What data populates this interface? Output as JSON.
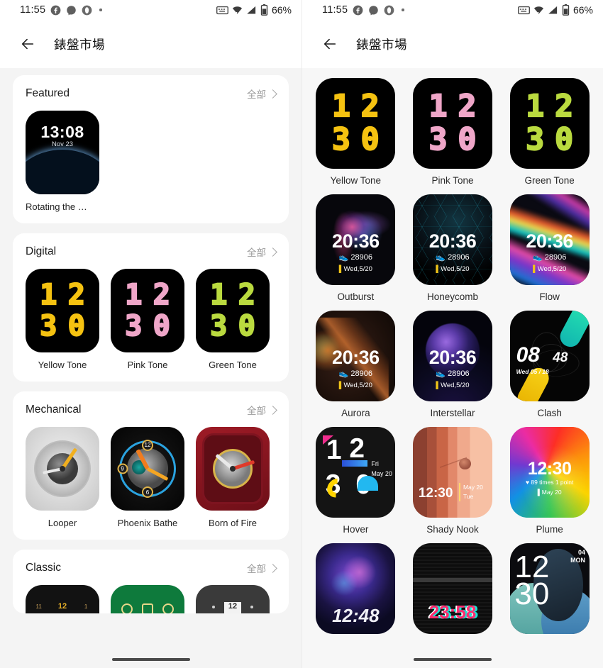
{
  "status_bar": {
    "time": "11:55",
    "battery_percent": "66%",
    "icons": [
      "facebook-icon",
      "messenger-icon",
      "opera-icon",
      "dot-indicator"
    ],
    "right_icons": [
      "keyboard-icon",
      "wifi-icon",
      "signal-icon",
      "battery-icon"
    ]
  },
  "app_bar": {
    "back_label": "back-arrow",
    "title": "錶盤市場"
  },
  "left_panel": {
    "sections": [
      {
        "title": "Featured",
        "more_label": "全部",
        "items": [
          {
            "name": "Rotating the …",
            "art": "earth",
            "time": "13:08",
            "date": "Nov 23"
          }
        ]
      },
      {
        "title": "Digital",
        "more_label": "全部",
        "items": [
          {
            "name": "Yellow Tone",
            "art": "tone",
            "color": "#f5c211",
            "digits": [
              "1",
              "2",
              "3",
              "0"
            ]
          },
          {
            "name": "Pink Tone",
            "art": "tone",
            "color": "#efa6c8",
            "digits": [
              "1",
              "2",
              "3",
              "0"
            ]
          },
          {
            "name": "Green Tone",
            "art": "tone",
            "color": "#bada3f",
            "digits": [
              "1",
              "2",
              "3",
              "0"
            ]
          }
        ]
      },
      {
        "title": "Mechanical",
        "more_label": "全部",
        "items": [
          {
            "name": "Looper",
            "art": "looper"
          },
          {
            "name": "Phoenix Bathe",
            "art": "phoenix"
          },
          {
            "name": "Born of Fire",
            "art": "bornfire"
          }
        ]
      },
      {
        "title": "Classic",
        "more_label": "全部",
        "items": [
          {
            "name": "",
            "art": "classic-black",
            "marks": [
              "11",
              "12",
              "1"
            ]
          },
          {
            "name": "",
            "art": "classic-green"
          },
          {
            "name": "",
            "art": "classic-grey",
            "window": "12"
          }
        ]
      }
    ]
  },
  "right_panel": {
    "grid": [
      {
        "name": "Yellow Tone",
        "art": "tone",
        "color": "#f5c211",
        "digits": [
          "1",
          "2",
          "3",
          "0"
        ]
      },
      {
        "name": "Pink Tone",
        "art": "tone",
        "color": "#efa6c8",
        "digits": [
          "1",
          "2",
          "3",
          "0"
        ]
      },
      {
        "name": "Green Tone",
        "art": "tone",
        "color": "#bada3f",
        "digits": [
          "1",
          "2",
          "3",
          "0"
        ]
      },
      {
        "name": "Outburst",
        "art": "outburst",
        "time": "20:36",
        "steps": "28906",
        "date": "Wed,5/20"
      },
      {
        "name": "Honeycomb",
        "art": "honeycomb",
        "time": "20:36",
        "steps": "28906",
        "date": "Wed,5/20"
      },
      {
        "name": "Flow",
        "art": "flow",
        "time": "20:36",
        "steps": "28906",
        "date": "Wed,5/20"
      },
      {
        "name": "Aurora",
        "art": "aurora",
        "time": "20:36",
        "steps": "28906",
        "date": "Wed,5/20"
      },
      {
        "name": "Interstellar",
        "art": "interstellar",
        "time": "20:36",
        "steps": "28906",
        "date": "Wed,5/20"
      },
      {
        "name": "Clash",
        "art": "clash",
        "hour": "08",
        "minute": "48",
        "date": "Wed 05 / 18"
      },
      {
        "name": "Hover",
        "art": "hover",
        "digits": [
          "1",
          "2",
          "3",
          "0"
        ],
        "day": "Fri",
        "date": "May 20"
      },
      {
        "name": "Shady Nook",
        "art": "shady",
        "time": "12:30",
        "date": "May  20",
        "day": "Tue"
      },
      {
        "name": "Plume",
        "art": "plume",
        "time": "12:30",
        "line1": "89 times 1 point",
        "line2": "May 20"
      },
      {
        "name": "",
        "art": "nebula",
        "time": "12:48"
      },
      {
        "name": "",
        "art": "glitch",
        "time": "23:58"
      },
      {
        "name": "",
        "art": "dial12",
        "num": "12",
        "num2": "30",
        "date_num": "04",
        "day": "MON"
      }
    ]
  }
}
